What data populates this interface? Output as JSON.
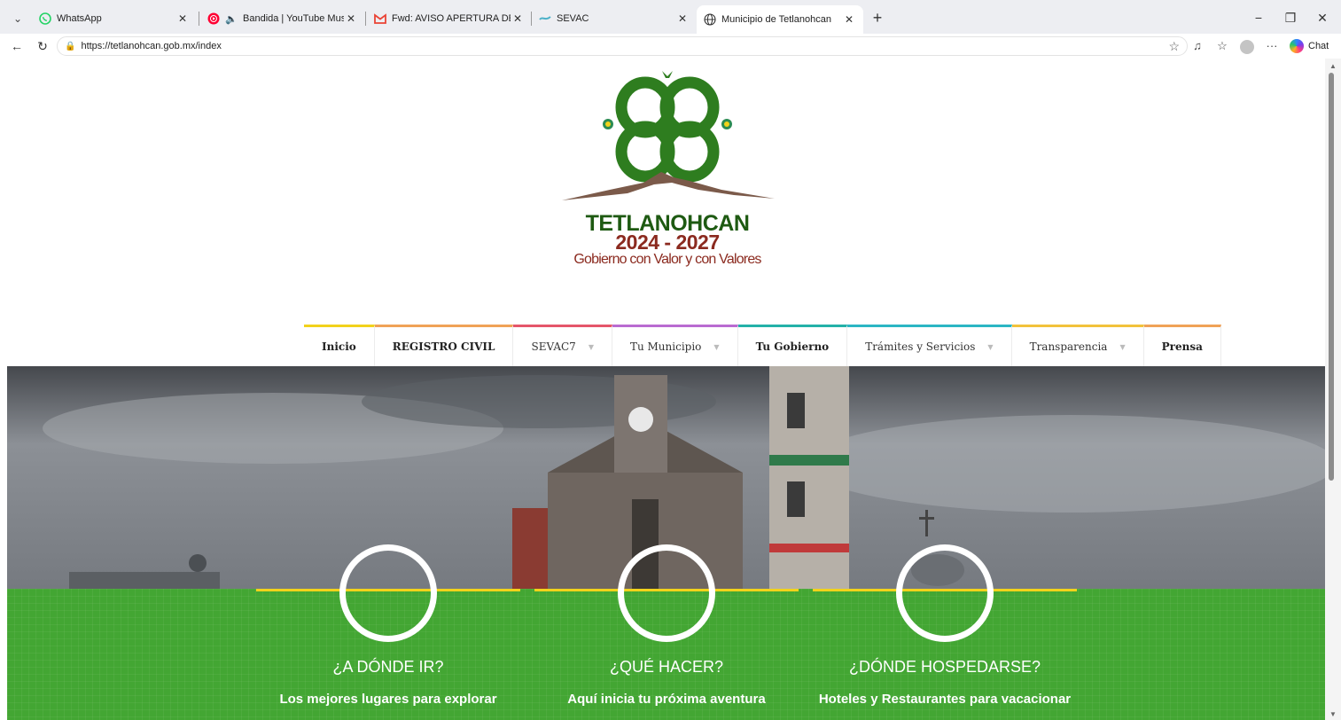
{
  "browser": {
    "tabs": [
      {
        "title": "WhatsApp",
        "icon": "whatsapp-icon"
      },
      {
        "title": "Bandida | YouTube Music",
        "icon": "youtube-music-icon"
      },
      {
        "title": "Fwd: AVISO APERTURA DE PLATAF",
        "icon": "gmail-icon"
      },
      {
        "title": "SEVAC",
        "icon": "sevac-icon"
      },
      {
        "title": "Municipio de Tetlanohcan",
        "icon": "globe-icon"
      }
    ],
    "url": "https://tetlanohcan.gob.mx/index",
    "chat_label": "Chat"
  },
  "logo": {
    "name": "TETLANOHCAN",
    "years": "2024 - 2027",
    "motto": "Gobierno con Valor y con Valores"
  },
  "menu": [
    {
      "label": "Inicio",
      "dropdown": false,
      "color": "#f2d21b"
    },
    {
      "label": "REGISTRO CIVIL",
      "dropdown": false,
      "color": "#f0a257"
    },
    {
      "label": "SEVAC7",
      "dropdown": true,
      "color": "#e5566a"
    },
    {
      "label": "Tu Municipio",
      "dropdown": true,
      "color": "#b96bd1"
    },
    {
      "label": "Tu Gobierno",
      "dropdown": false,
      "color": "#24b1a8"
    },
    {
      "label": "Trámites y Servicios",
      "dropdown": true,
      "color": "#2bb6c4"
    },
    {
      "label": "Transparencia",
      "dropdown": true,
      "color": "#f2c23b"
    },
    {
      "label": "Prensa",
      "dropdown": false,
      "color": "#f0a257"
    }
  ],
  "features": [
    {
      "title": "¿A DÓNDE IR?",
      "subtitle": "Los mejores lugares para explorar"
    },
    {
      "title": "¿QUÉ HACER?",
      "subtitle": "Aquí inicia tu próxima aventura"
    },
    {
      "title": "¿DÓNDE HOSPEDARSE?",
      "subtitle": "Hoteles y Restaurantes para vacacionar"
    }
  ],
  "colors": {
    "band_green": "#43a633",
    "accent_yellow": "#f2d21b",
    "logo_green": "#2e7d1f",
    "logo_red": "#8b2a1f"
  }
}
